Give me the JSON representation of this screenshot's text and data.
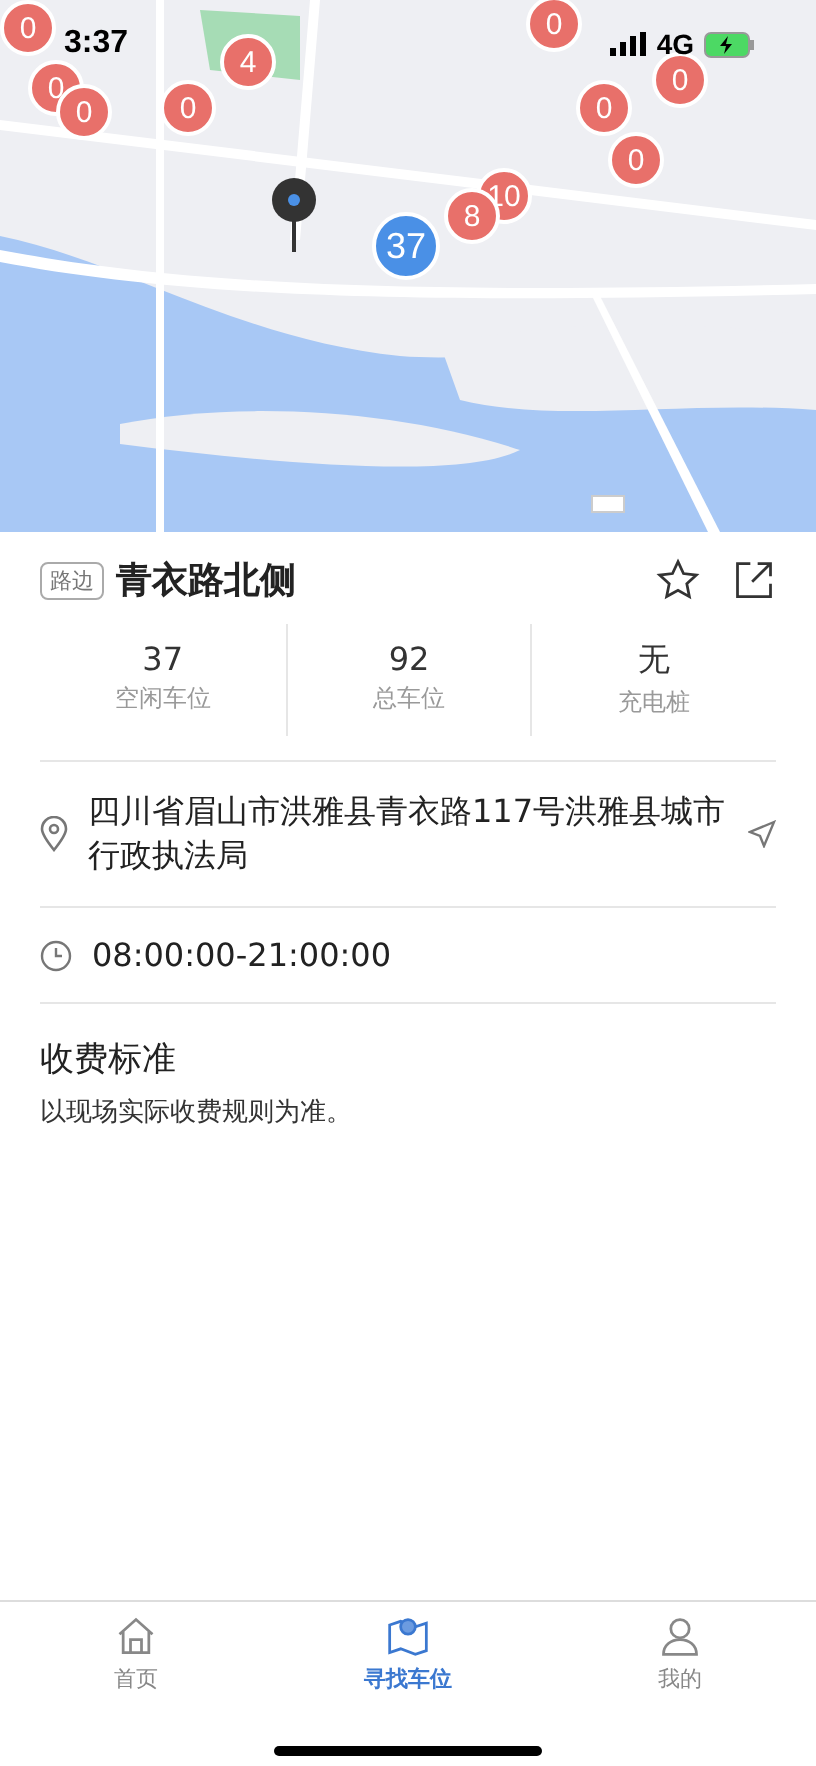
{
  "status_bar": {
    "time": "3:37",
    "network": "4G"
  },
  "map": {
    "markers": [
      {
        "count": "0",
        "selected": false
      },
      {
        "count": "0",
        "selected": false
      },
      {
        "count": "0",
        "selected": false
      },
      {
        "count": "4",
        "selected": false
      },
      {
        "count": "0",
        "selected": false
      },
      {
        "count": "0",
        "selected": false
      },
      {
        "count": "0",
        "selected": false
      },
      {
        "count": "0",
        "selected": false
      },
      {
        "count": "0",
        "selected": false
      },
      {
        "count": "10",
        "selected": false
      },
      {
        "count": "8",
        "selected": false
      },
      {
        "count": "37",
        "selected": true
      }
    ]
  },
  "spot": {
    "tag": "路边",
    "name": "青衣路北侧",
    "stats": [
      {
        "value": "37",
        "label": "空闲车位"
      },
      {
        "value": "92",
        "label": "总车位"
      },
      {
        "value": "无",
        "label": "充电桩"
      }
    ],
    "address": "四川省眉山市洪雅县青衣路117号洪雅县城市行政执法局",
    "hours": "08:00:00-21:00:00",
    "fee_title": "收费标准",
    "fee_text": "以现场实际收费规则为准。"
  },
  "tabs": [
    {
      "label": "首页",
      "selected": false
    },
    {
      "label": "寻找车位",
      "selected": true
    },
    {
      "label": "我的",
      "selected": false
    }
  ]
}
